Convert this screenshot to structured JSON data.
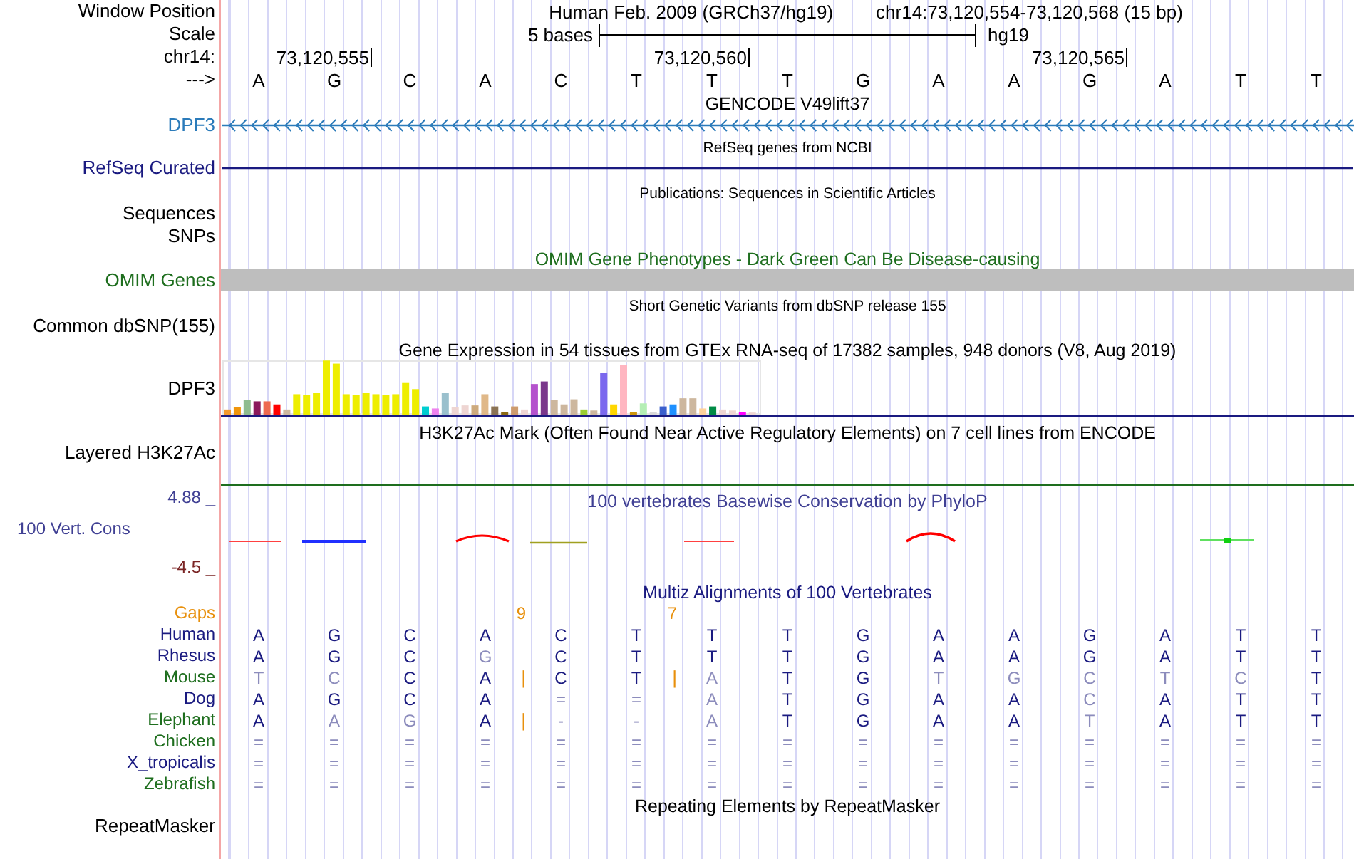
{
  "header": {
    "position_label": "Window Position",
    "assembly_title": "Human Feb. 2009 (GRCh37/hg19)",
    "position": "chr14:73,120,554-73,120,568 (15 bp)",
    "scale_label": "Scale",
    "scale_text": "5 bases",
    "scale_db": "hg19",
    "chrom_label": "chr14:",
    "ticks": [
      "73,120,555",
      "73,120,560",
      "73,120,565"
    ],
    "strand_label": "--->",
    "bases": [
      "A",
      "G",
      "C",
      "A",
      "C",
      "T",
      "T",
      "T",
      "G",
      "A",
      "A",
      "G",
      "A",
      "T",
      "T"
    ]
  },
  "tracks": [
    {
      "kind": "gene",
      "title": "GENCODE V49lift37",
      "labels": [
        "DPF3"
      ],
      "color": "#2b7bba"
    },
    {
      "kind": "transcripts",
      "title": "RefSeq genes from NCBI",
      "labels": [
        "RefSeq Curated"
      ],
      "color": "#1a1a80"
    },
    {
      "kind": "literature",
      "title": "Publications: Sequences in Scientific Articles",
      "labels": [
        "Sequences",
        "SNPs"
      ]
    },
    {
      "kind": "omim",
      "title": "OMIM Gene Phenotypes - Dark Green Can Be Disease-causing",
      "labels": [
        "OMIM Genes"
      ],
      "color": "#1e6e1e"
    },
    {
      "kind": "variants",
      "title": "Short Genetic Variants from dbSNP release 155",
      "labels": [
        "Common dbSNP(155)"
      ]
    },
    {
      "kind": "expression",
      "title": "Gene Expression in 54 tissues from GTEx RNA-seq of 17382 samples, 948 donors (V8, Aug 2019)",
      "labels": [
        "DPF3"
      ]
    },
    {
      "kind": "histone",
      "title": "H3K27Ac Mark (Often Found Near Active Regulatory Elements) on 7 cell lines from ENCODE",
      "labels": [
        "Layered H3K27Ac"
      ]
    },
    {
      "kind": "conservation",
      "title": "100 vertebrates Basewise Conservation by PhyloP",
      "labels": [
        "100 Vert. Cons"
      ],
      "color": "#404094",
      "max": "4.88 _",
      "min": "-4.5 _"
    },
    {
      "kind": "alignment",
      "title": "Multiz Alignments of 100 Vertebrates",
      "gaps_label": "Gaps",
      "gaps": [
        "9",
        "7"
      ],
      "species": [
        {
          "name": "Human",
          "color": "#1a1a80",
          "bases": [
            {
              "b": "A",
              "faint": false
            },
            {
              "b": "G",
              "faint": false
            },
            {
              "b": "C",
              "faint": false
            },
            {
              "b": "A",
              "faint": false
            },
            {
              "b": "C",
              "faint": false
            },
            {
              "b": "T",
              "faint": false
            },
            {
              "b": "T",
              "faint": false
            },
            {
              "b": "T",
              "faint": false
            },
            {
              "b": "G",
              "faint": false
            },
            {
              "b": "A",
              "faint": false
            },
            {
              "b": "A",
              "faint": false
            },
            {
              "b": "G",
              "faint": false
            },
            {
              "b": "A",
              "faint": false
            },
            {
              "b": "T",
              "faint": false
            },
            {
              "b": "T",
              "faint": false
            }
          ]
        },
        {
          "name": "Rhesus",
          "color": "#1a1a80",
          "bases": [
            {
              "b": "A",
              "faint": false
            },
            {
              "b": "G",
              "faint": false
            },
            {
              "b": "C",
              "faint": false
            },
            {
              "b": "G",
              "faint": true
            },
            {
              "b": "C",
              "faint": false
            },
            {
              "b": "T",
              "faint": false
            },
            {
              "b": "T",
              "faint": false
            },
            {
              "b": "T",
              "faint": false
            },
            {
              "b": "G",
              "faint": false
            },
            {
              "b": "A",
              "faint": false
            },
            {
              "b": "A",
              "faint": false
            },
            {
              "b": "G",
              "faint": false
            },
            {
              "b": "A",
              "faint": false
            },
            {
              "b": "T",
              "faint": false
            },
            {
              "b": "T",
              "faint": false
            }
          ]
        },
        {
          "name": "Mouse",
          "color": "#1e6e1e",
          "bases": [
            {
              "b": "T",
              "faint": true
            },
            {
              "b": "C",
              "faint": true
            },
            {
              "b": "C",
              "faint": false
            },
            {
              "b": "A",
              "faint": false,
              "insert_after": "|"
            },
            {
              "b": "C",
              "faint": false
            },
            {
              "b": "T",
              "faint": false,
              "insert_after": "|"
            },
            {
              "b": "A",
              "faint": true
            },
            {
              "b": "T",
              "faint": false
            },
            {
              "b": "G",
              "faint": false
            },
            {
              "b": "T",
              "faint": true
            },
            {
              "b": "G",
              "faint": true
            },
            {
              "b": "C",
              "faint": true
            },
            {
              "b": "T",
              "faint": true
            },
            {
              "b": "C",
              "faint": true
            },
            {
              "b": "T",
              "faint": false
            }
          ]
        },
        {
          "name": "Dog",
          "color": "#1a1a80",
          "bases": [
            {
              "b": "A",
              "faint": false
            },
            {
              "b": "G",
              "faint": false
            },
            {
              "b": "C",
              "faint": false
            },
            {
              "b": "A",
              "faint": false
            },
            {
              "b": "=",
              "faint": true
            },
            {
              "b": "=",
              "faint": true
            },
            {
              "b": "A",
              "faint": true
            },
            {
              "b": "T",
              "faint": false
            },
            {
              "b": "G",
              "faint": false
            },
            {
              "b": "A",
              "faint": false
            },
            {
              "b": "A",
              "faint": false
            },
            {
              "b": "C",
              "faint": true
            },
            {
              "b": "A",
              "faint": false
            },
            {
              "b": "T",
              "faint": false
            },
            {
              "b": "T",
              "faint": false
            }
          ]
        },
        {
          "name": "Elephant",
          "color": "#1e6e1e",
          "bases": [
            {
              "b": "A",
              "faint": false
            },
            {
              "b": "A",
              "faint": true
            },
            {
              "b": "G",
              "faint": true
            },
            {
              "b": "A",
              "faint": false,
              "insert_after": "|"
            },
            {
              "b": "-",
              "faint": true
            },
            {
              "b": "-",
              "faint": true
            },
            {
              "b": "A",
              "faint": true
            },
            {
              "b": "T",
              "faint": false
            },
            {
              "b": "G",
              "faint": false
            },
            {
              "b": "A",
              "faint": false
            },
            {
              "b": "A",
              "faint": false
            },
            {
              "b": "T",
              "faint": true
            },
            {
              "b": "A",
              "faint": false
            },
            {
              "b": "T",
              "faint": false
            },
            {
              "b": "T",
              "faint": false
            }
          ]
        },
        {
          "name": "Chicken",
          "color": "#1e6e1e",
          "bases": [
            {
              "b": "=",
              "faint": true
            },
            {
              "b": "=",
              "faint": true
            },
            {
              "b": "=",
              "faint": true
            },
            {
              "b": "=",
              "faint": true
            },
            {
              "b": "=",
              "faint": true
            },
            {
              "b": "=",
              "faint": true
            },
            {
              "b": "=",
              "faint": true
            },
            {
              "b": "=",
              "faint": true
            },
            {
              "b": "=",
              "faint": true
            },
            {
              "b": "=",
              "faint": true
            },
            {
              "b": "=",
              "faint": true
            },
            {
              "b": "=",
              "faint": true
            },
            {
              "b": "=",
              "faint": true
            },
            {
              "b": "=",
              "faint": true
            },
            {
              "b": "=",
              "faint": true
            }
          ]
        },
        {
          "name": "X_tropicalis",
          "color": "#1a1a80",
          "bases": [
            {
              "b": "=",
              "faint": true
            },
            {
              "b": "=",
              "faint": true
            },
            {
              "b": "=",
              "faint": true
            },
            {
              "b": "=",
              "faint": true
            },
            {
              "b": "=",
              "faint": true
            },
            {
              "b": "=",
              "faint": true
            },
            {
              "b": "=",
              "faint": true
            },
            {
              "b": "=",
              "faint": true
            },
            {
              "b": "=",
              "faint": true
            },
            {
              "b": "=",
              "faint": true
            },
            {
              "b": "=",
              "faint": true
            },
            {
              "b": "=",
              "faint": true
            },
            {
              "b": "=",
              "faint": true
            },
            {
              "b": "=",
              "faint": true
            },
            {
              "b": "=",
              "faint": true
            }
          ]
        },
        {
          "name": "Zebrafish",
          "color": "#1e6e1e",
          "bases": [
            {
              "b": "=",
              "faint": true
            },
            {
              "b": "=",
              "faint": true
            },
            {
              "b": "=",
              "faint": true
            },
            {
              "b": "=",
              "faint": true
            },
            {
              "b": "=",
              "faint": true
            },
            {
              "b": "=",
              "faint": true
            },
            {
              "b": "=",
              "faint": true
            },
            {
              "b": "=",
              "faint": true
            },
            {
              "b": "=",
              "faint": true
            },
            {
              "b": "=",
              "faint": true
            },
            {
              "b": "=",
              "faint": true
            },
            {
              "b": "=",
              "faint": true
            },
            {
              "b": "=",
              "faint": true
            },
            {
              "b": "=",
              "faint": true
            },
            {
              "b": "=",
              "faint": true
            }
          ]
        }
      ]
    },
    {
      "kind": "repeats",
      "title": "Repeating Elements by RepeatMasker",
      "labels": [
        "RepeatMasker"
      ]
    }
  ]
}
